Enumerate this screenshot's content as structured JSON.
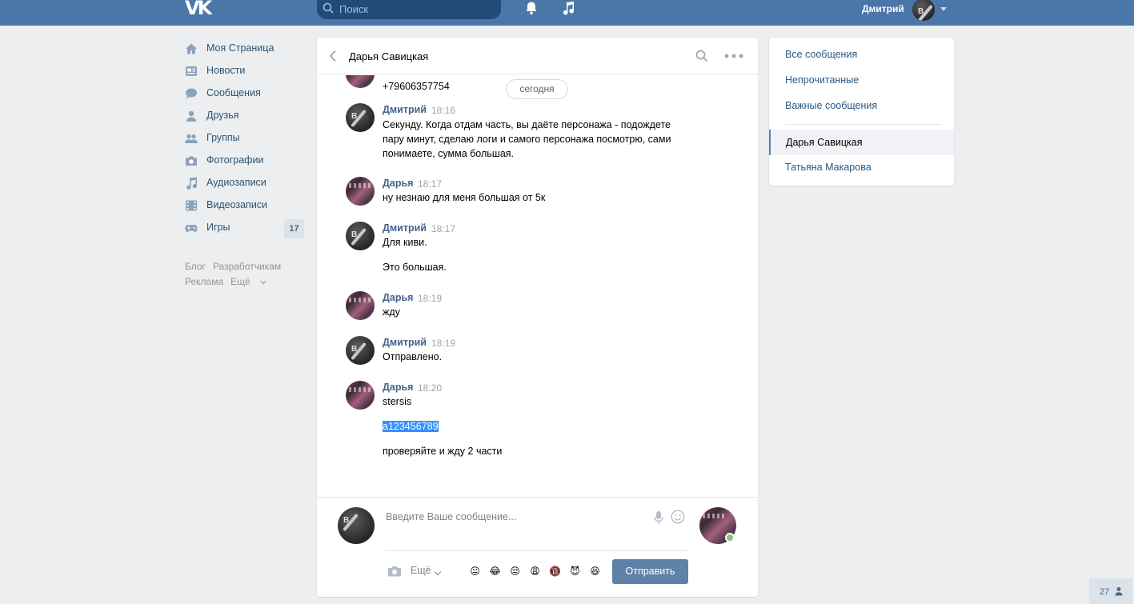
{
  "header": {
    "logo": "VK",
    "search_placeholder": "Поиск",
    "user_name": "Дмитрий",
    "icons": [
      "vk-logo-icon",
      "search-icon",
      "bell-icon",
      "music-icon",
      "chevron-down-icon"
    ]
  },
  "menu": {
    "items": [
      {
        "label": "Моя Страница",
        "icon": "home-icon"
      },
      {
        "label": "Новости",
        "icon": "news-icon"
      },
      {
        "label": "Сообщения",
        "icon": "messages-icon"
      },
      {
        "label": "Друзья",
        "icon": "friend-icon"
      },
      {
        "label": "Группы",
        "icon": "groups-icon"
      },
      {
        "label": "Фотографии",
        "icon": "camera-icon"
      },
      {
        "label": "Аудиозаписи",
        "icon": "music-icon"
      },
      {
        "label": "Видеозаписи",
        "icon": "video-icon"
      },
      {
        "label": "Игры",
        "icon": "gamepad-icon",
        "count": "17"
      }
    ],
    "footer": [
      "Блог",
      "Разработчикам",
      "Реклама",
      "Ещё"
    ]
  },
  "chat": {
    "title": "Дарья Савицкая",
    "date_divider": "сегодня",
    "top_cut_text": "+79606357754",
    "messages": [
      {
        "author": "Дмитрий",
        "time": "18:16",
        "lines": [
          "Секунду. Когда отдам часть, вы даёте персонажа - подождете",
          "пару минут, сделаю логи и самого персонажа посмотрю, сами",
          "понимаете, сумма большая."
        ]
      },
      {
        "author": "Дарья",
        "time": "18:17",
        "lines": [
          "ну незнаю для меня большая от 5к"
        ]
      },
      {
        "author": "Дмитрий",
        "time": "18:17",
        "lines": [
          "Для киви.",
          "Это большая."
        ]
      },
      {
        "author": "Дарья",
        "time": "18:19",
        "lines": [
          "жду"
        ]
      },
      {
        "author": "Дмитрий",
        "time": "18:19",
        "lines": [
          "Отправлено."
        ]
      },
      {
        "author": "Дарья",
        "time": "18:20",
        "lines": [
          "stersis",
          "a123456789",
          "проверяйте и жду 2 части"
        ]
      }
    ]
  },
  "compose": {
    "placeholder": "Введите Ваше сообщение...",
    "more_label": "Ещё",
    "send_label": "Отправить",
    "emojis": [
      "😐",
      "😂",
      "😒",
      "😩",
      "🔞",
      "😈",
      "😆"
    ]
  },
  "right_panel": {
    "items": [
      "Все сообщения",
      "Непрочитанные",
      "Важные сообщения"
    ],
    "active_dialog": "Дарья Савицкая",
    "other_dialog": "Татьяна Макарова"
  },
  "bottom_badge": {
    "count": "27"
  },
  "colors": {
    "header_bg": "#4a76a8",
    "link": "#2a5885",
    "send_button": "#5e81a8",
    "page_bg": "#edeef0"
  }
}
